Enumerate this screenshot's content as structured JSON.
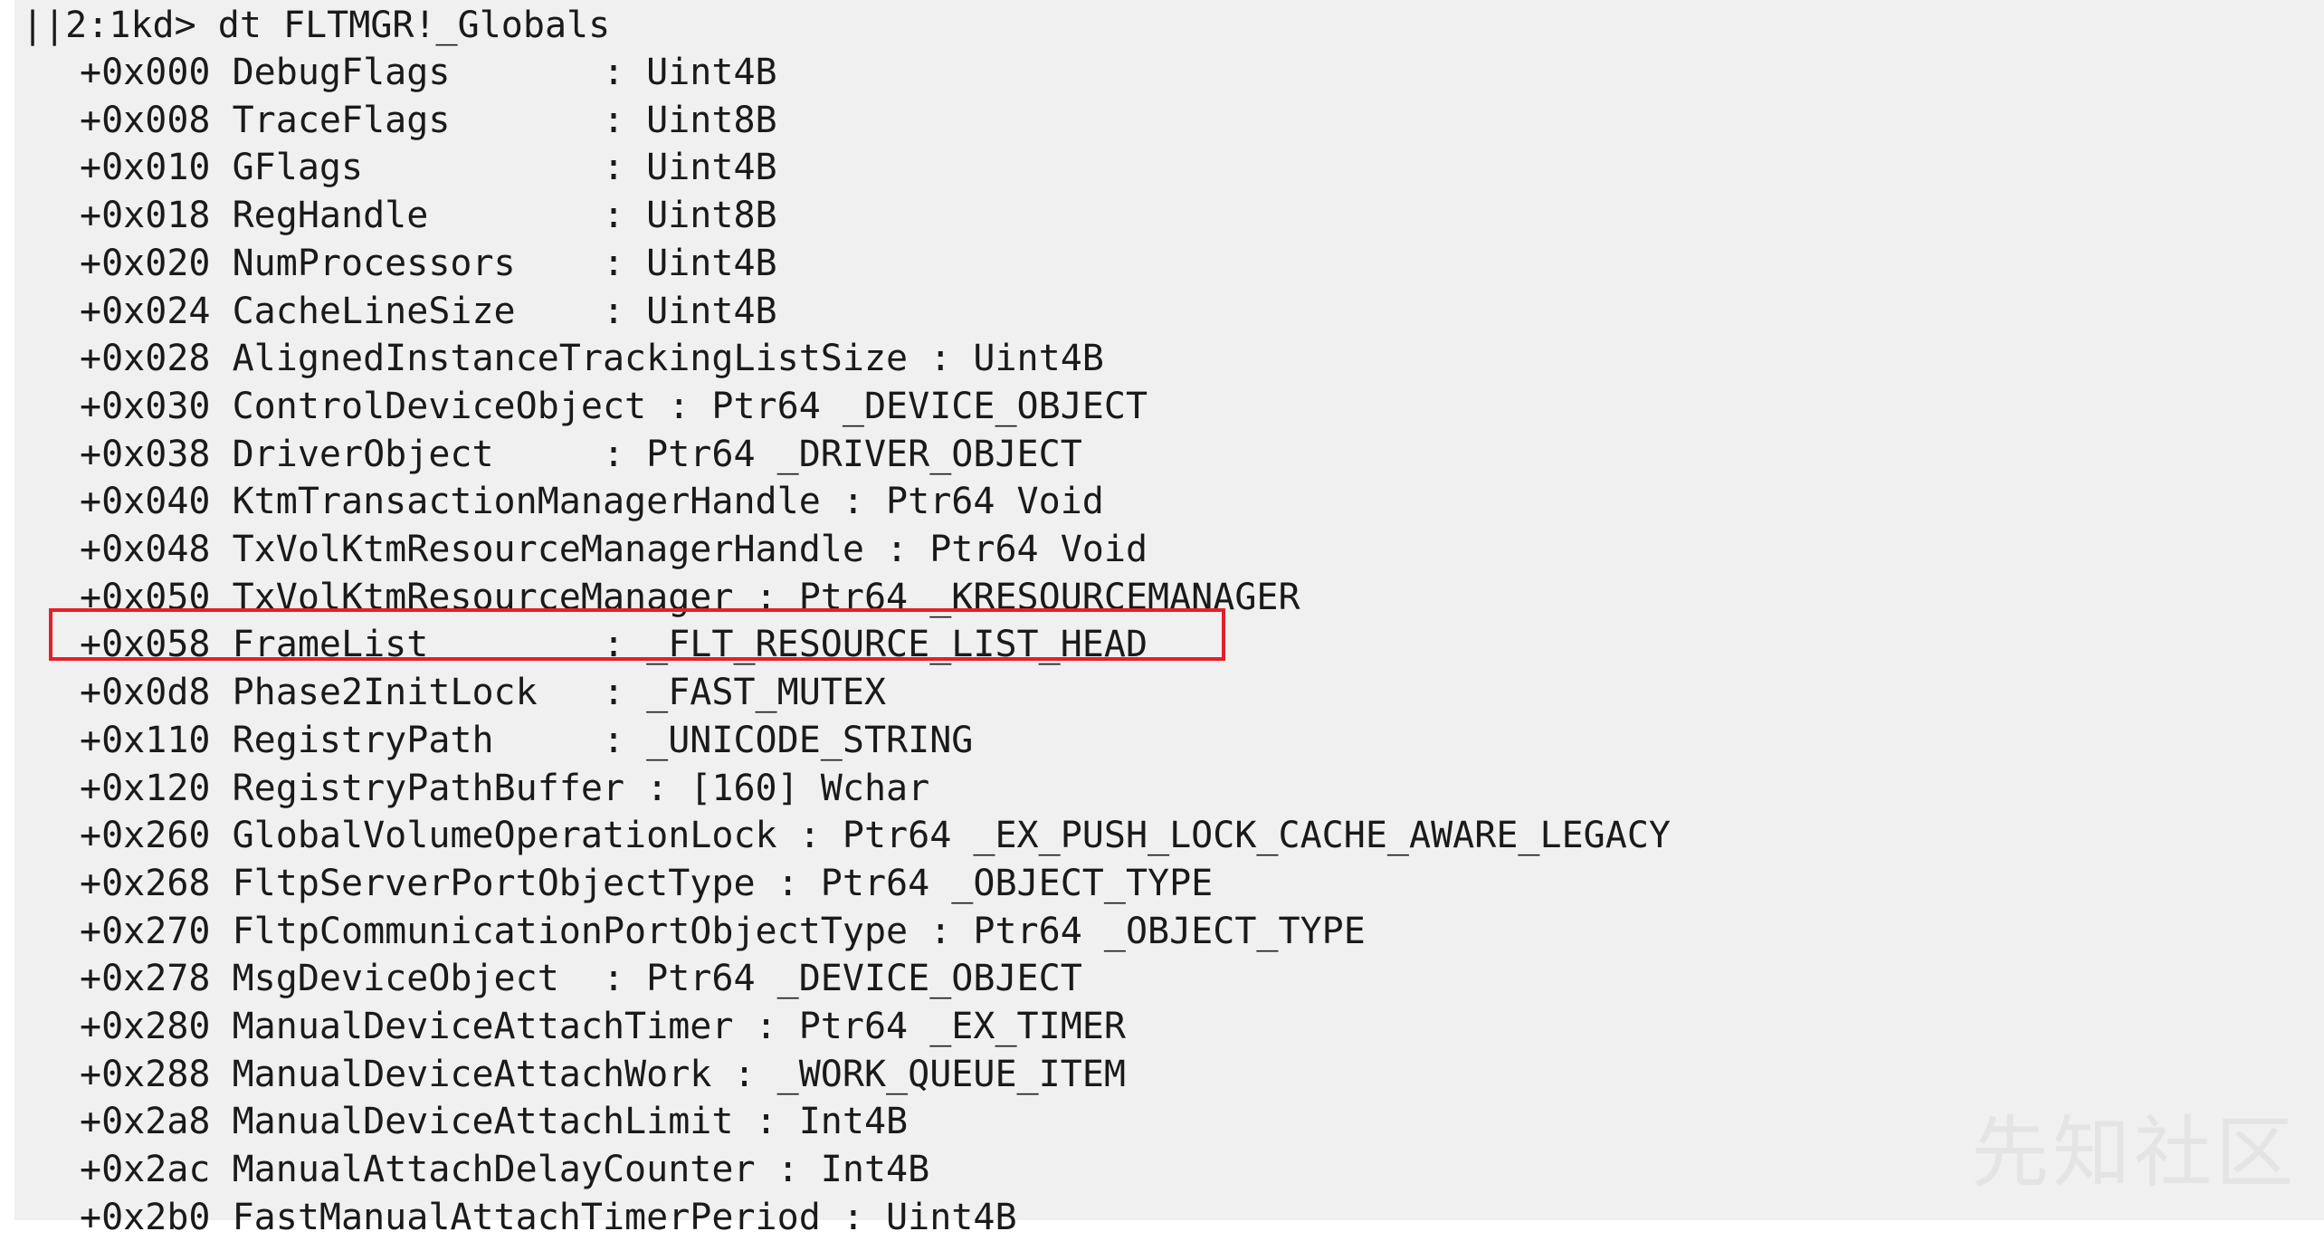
{
  "console": {
    "prompt_line": "||2:1kd> dt FLTMGR!_Globals",
    "highlighted_row": 12,
    "fields": [
      "+0x000 DebugFlags       : Uint4B",
      "+0x008 TraceFlags       : Uint8B",
      "+0x010 GFlags           : Uint4B",
      "+0x018 RegHandle        : Uint8B",
      "+0x020 NumProcessors    : Uint4B",
      "+0x024 CacheLineSize    : Uint4B",
      "+0x028 AlignedInstanceTrackingListSize : Uint4B",
      "+0x030 ControlDeviceObject : Ptr64 _DEVICE_OBJECT",
      "+0x038 DriverObject     : Ptr64 _DRIVER_OBJECT",
      "+0x040 KtmTransactionManagerHandle : Ptr64 Void",
      "+0x048 TxVolKtmResourceManagerHandle : Ptr64 Void",
      "+0x050 TxVolKtmResourceManager : Ptr64 _KRESOURCEMANAGER",
      "+0x058 FrameList        : _FLT_RESOURCE_LIST_HEAD",
      "+0x0d8 Phase2InitLock   : _FAST_MUTEX",
      "+0x110 RegistryPath     : _UNICODE_STRING",
      "+0x120 RegistryPathBuffer : [160] Wchar",
      "+0x260 GlobalVolumeOperationLock : Ptr64 _EX_PUSH_LOCK_CACHE_AWARE_LEGACY",
      "+0x268 FltpServerPortObjectType : Ptr64 _OBJECT_TYPE",
      "+0x270 FltpCommunicationPortObjectType : Ptr64 _OBJECT_TYPE",
      "+0x278 MsgDeviceObject  : Ptr64 _DEVICE_OBJECT",
      "+0x280 ManualDeviceAttachTimer : Ptr64 _EX_TIMER",
      "+0x288 ManualDeviceAttachWork : _WORK_QUEUE_ITEM",
      "+0x2a8 ManualDeviceAttachLimit : Int4B",
      "+0x2ac ManualAttachDelayCounter : Int4B",
      "+0x2b0 FastManualAttachTimerPeriod : Uint4B"
    ]
  },
  "watermark": "先知社区",
  "colors": {
    "background": "#f0f0f0",
    "text": "#1a1a1a",
    "highlight_border": "#e3202a"
  }
}
